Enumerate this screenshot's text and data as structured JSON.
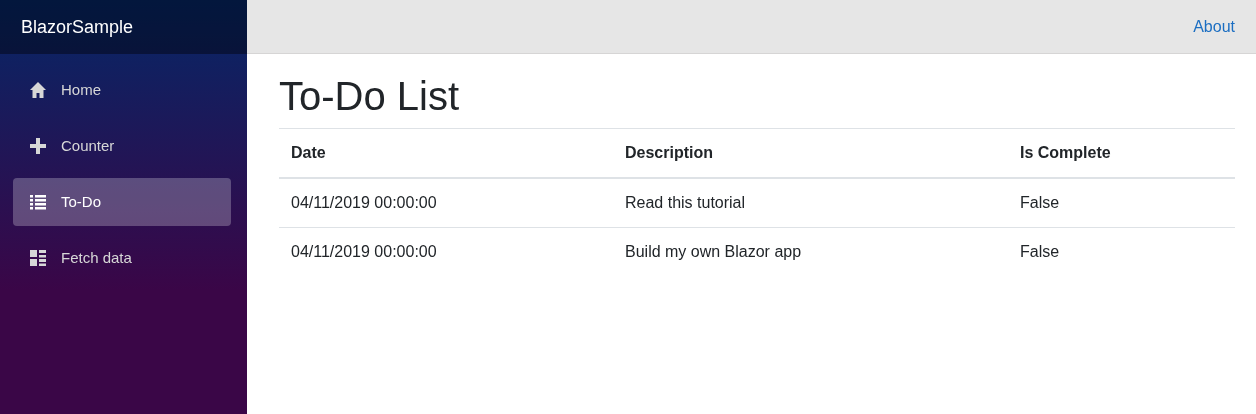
{
  "app": {
    "brand": "BlazorSample"
  },
  "sidebar": {
    "items": [
      {
        "label": "Home",
        "selected": false
      },
      {
        "label": "Counter",
        "selected": false
      },
      {
        "label": "To-Do",
        "selected": true
      },
      {
        "label": "Fetch data",
        "selected": false
      }
    ]
  },
  "top_bar": {
    "link": "About"
  },
  "page": {
    "title": "To-Do List"
  },
  "table": {
    "columns": [
      "Date",
      "Description",
      "Is Complete"
    ],
    "rows": [
      [
        "04/11/2019 00:00:00",
        "Read this tutorial",
        "False"
      ],
      [
        "04/11/2019 00:00:00",
        "Build my own Blazor app",
        "False"
      ]
    ]
  }
}
